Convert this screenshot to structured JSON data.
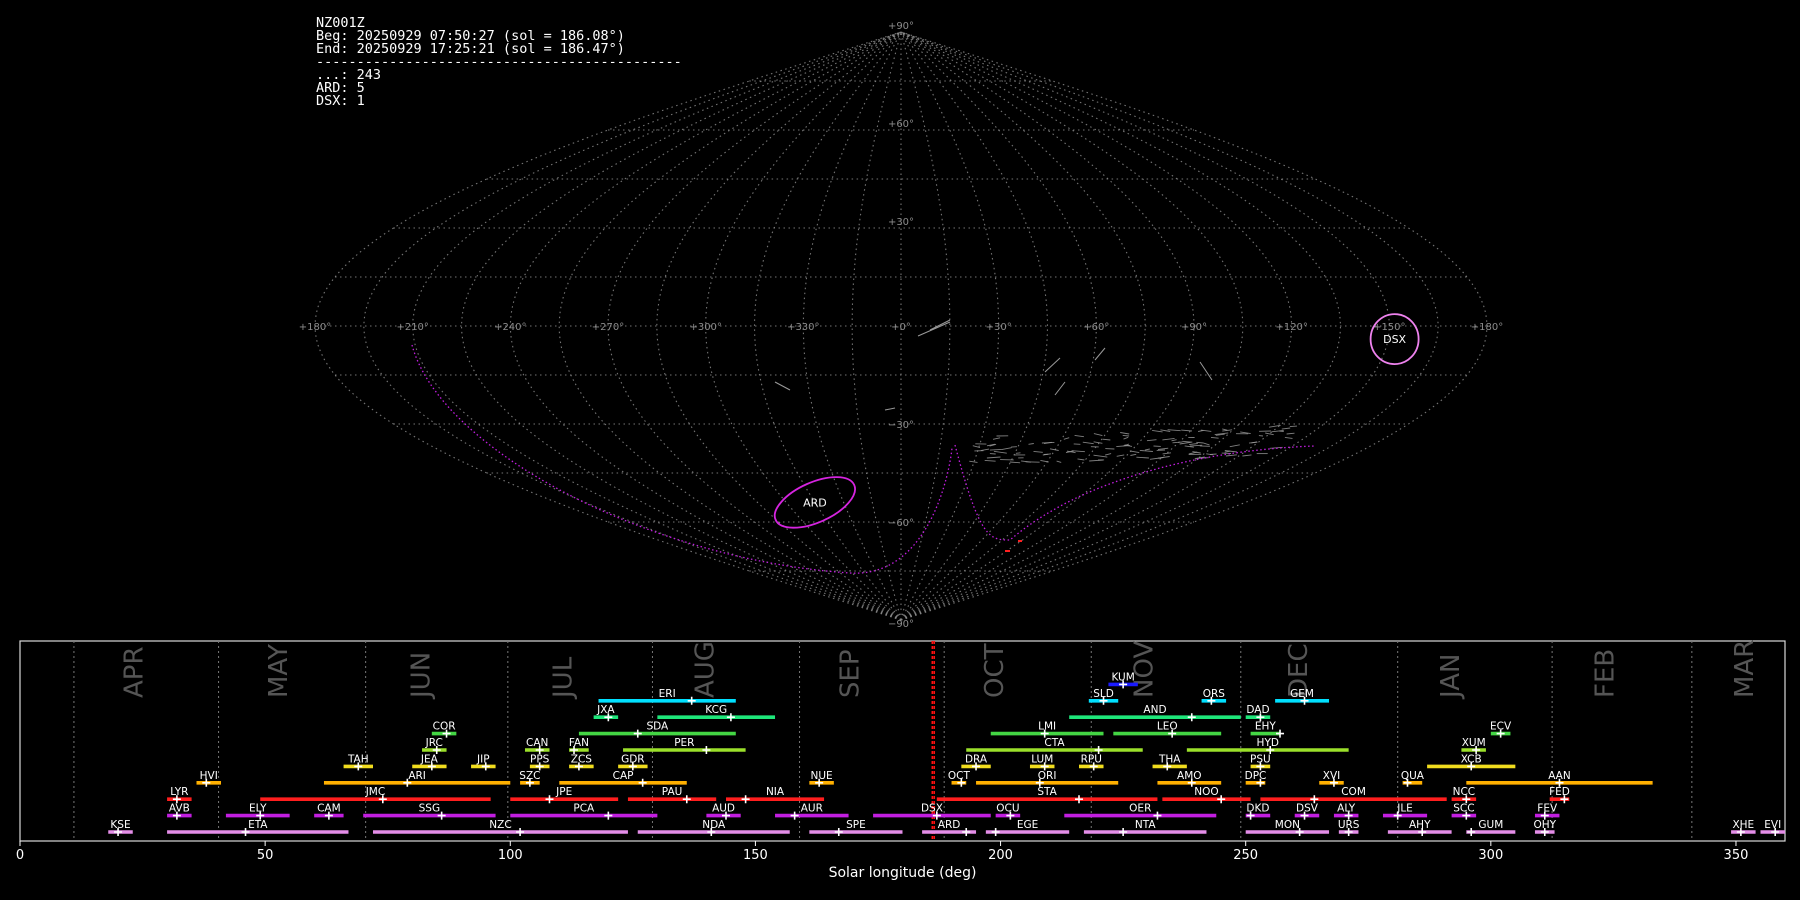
{
  "header": {
    "lines": [
      "NZ001Z",
      "Beg: 20250929 07:50:27 (sol = 186.08°)",
      "End: 20250929 17:25:21 (sol = 186.47°)",
      "---------------------------------------------",
      "...: 243",
      "ARD: 5",
      "DSX: 1"
    ]
  },
  "chart_data": [
    {
      "type": "scatter",
      "projection": "sinusoidal all-sky map",
      "grid": true,
      "lon_ticks": [
        "+180°",
        "+150°",
        "+120°",
        "+90°",
        "+60°",
        "+30°",
        "+0°",
        "+330°",
        "+300°",
        "+270°",
        "+240°",
        "+210°",
        "+180°"
      ],
      "lat_ticks": [
        "+90°",
        "+60°",
        "+30°",
        "−30°",
        "−60°",
        "−90°"
      ],
      "radiants": [
        {
          "name": "DSX",
          "lon": 152,
          "lat": -4,
          "color": "#ee82ee"
        },
        {
          "name": "ARD",
          "lon": 315,
          "lat": -54,
          "color": "#d624e0"
        }
      ],
      "counts": {
        "sporadic": 243,
        "ARD": 5,
        "DSX": 1
      }
    },
    {
      "type": "bar",
      "title": "",
      "xlabel": "Solar longitude (deg)",
      "xlim": [
        0,
        360
      ],
      "xticks": [
        0,
        50,
        100,
        150,
        200,
        250,
        300,
        350
      ],
      "current_sol": [
        186.08,
        186.47
      ],
      "months": [
        {
          "label": "APR",
          "x": 25
        },
        {
          "label": "MAY",
          "x": 54.5
        },
        {
          "label": "JUN",
          "x": 83.5
        },
        {
          "label": "JUL",
          "x": 112.5
        },
        {
          "label": "AUG",
          "x": 141.5
        },
        {
          "label": "SEP",
          "x": 171
        },
        {
          "label": "OCT",
          "x": 200.5
        },
        {
          "label": "NOV",
          "x": 231
        },
        {
          "label": "DEC",
          "x": 262.5
        },
        {
          "label": "JAN",
          "x": 293.5
        },
        {
          "label": "FEB",
          "x": 325
        },
        {
          "label": "MAR",
          "x": 353.5
        }
      ],
      "month_boundaries": [
        11,
        40.5,
        70.5,
        99.5,
        129,
        159,
        188.5,
        218.5,
        249,
        281,
        312.5,
        341
      ],
      "showers": [
        {
          "code": "KUM",
          "start": 222,
          "end": 228,
          "peak": 225,
          "row": 9,
          "color": "#1a1aff"
        },
        {
          "code": "ERI",
          "start": 118,
          "end": 146,
          "peak": 137,
          "row": 8,
          "color": "#00e0ff"
        },
        {
          "code": "SLD",
          "start": 218,
          "end": 224,
          "peak": 221,
          "row": 8,
          "color": "#00e0ff"
        },
        {
          "code": "ORS",
          "start": 241,
          "end": 246,
          "peak": 243,
          "row": 8,
          "color": "#00e0ff"
        },
        {
          "code": "GEM",
          "start": 256,
          "end": 267,
          "peak": 262,
          "row": 8,
          "color": "#00e0ff"
        },
        {
          "code": "JXA",
          "start": 117,
          "end": 122,
          "peak": 120,
          "row": 7,
          "color": "#1ee67a"
        },
        {
          "code": "KCG",
          "start": 130,
          "end": 154,
          "peak": 145,
          "row": 7,
          "color": "#1ee67a"
        },
        {
          "code": "AND",
          "start": 214,
          "end": 249,
          "peak": 239,
          "row": 7,
          "color": "#1ee67a"
        },
        {
          "code": "DAD",
          "start": 250,
          "end": 255,
          "peak": 253,
          "row": 7,
          "color": "#1ee67a"
        },
        {
          "code": "COR",
          "start": 84,
          "end": 89,
          "peak": 87,
          "row": 6,
          "color": "#44d644"
        },
        {
          "code": "SDA",
          "start": 114,
          "end": 146,
          "peak": 126,
          "row": 6,
          "color": "#44d644"
        },
        {
          "code": "LMI",
          "start": 198,
          "end": 221,
          "peak": 209,
          "row": 6,
          "color": "#44d644"
        },
        {
          "code": "LEO",
          "start": 223,
          "end": 245,
          "peak": 235,
          "row": 6,
          "color": "#44d644"
        },
        {
          "code": "EHY",
          "start": 251,
          "end": 257,
          "peak": 257,
          "row": 6,
          "color": "#44d644"
        },
        {
          "code": "ECV",
          "start": 300,
          "end": 304,
          "peak": 302,
          "row": 6,
          "color": "#44d644"
        },
        {
          "code": "JRC",
          "start": 82,
          "end": 87,
          "peak": 85,
          "row": 5,
          "color": "#9be02a"
        },
        {
          "code": "CAN",
          "start": 103,
          "end": 108,
          "peak": 106,
          "row": 5,
          "color": "#9be02a"
        },
        {
          "code": "FAN",
          "start": 112,
          "end": 116,
          "peak": 113,
          "row": 5,
          "color": "#9be02a"
        },
        {
          "code": "PER",
          "start": 123,
          "end": 148,
          "peak": 140,
          "row": 5,
          "color": "#9be02a"
        },
        {
          "code": "CTA",
          "start": 193,
          "end": 229,
          "peak": 220,
          "row": 5,
          "color": "#9be02a"
        },
        {
          "code": "HYD",
          "start": 238,
          "end": 271,
          "peak": 255,
          "row": 5,
          "color": "#9be02a"
        },
        {
          "code": "XUM",
          "start": 294,
          "end": 299,
          "peak": 297,
          "row": 5,
          "color": "#9be02a"
        },
        {
          "code": "TAH",
          "start": 66,
          "end": 72,
          "peak": 69,
          "row": 4,
          "color": "#f0dc1e"
        },
        {
          "code": "JEA",
          "start": 80,
          "end": 87,
          "peak": 84,
          "row": 4,
          "color": "#f0dc1e"
        },
        {
          "code": "JIP",
          "start": 92,
          "end": 97,
          "peak": 95,
          "row": 4,
          "color": "#f0dc1e"
        },
        {
          "code": "PPS",
          "start": 104,
          "end": 108,
          "peak": 106,
          "row": 4,
          "color": "#f0dc1e"
        },
        {
          "code": "ZCS",
          "start": 112,
          "end": 117,
          "peak": 114,
          "row": 4,
          "color": "#f0dc1e"
        },
        {
          "code": "GDR",
          "start": 122,
          "end": 128,
          "peak": 125,
          "row": 4,
          "color": "#f0dc1e"
        },
        {
          "code": "DRA",
          "start": 192,
          "end": 198,
          "peak": 195,
          "row": 4,
          "color": "#f0dc1e"
        },
        {
          "code": "LUM",
          "start": 206,
          "end": 211,
          "peak": 209,
          "row": 4,
          "color": "#f0dc1e"
        },
        {
          "code": "RPU",
          "start": 216,
          "end": 221,
          "peak": 219,
          "row": 4,
          "color": "#f0dc1e"
        },
        {
          "code": "THA",
          "start": 231,
          "end": 238,
          "peak": 234,
          "row": 4,
          "color": "#f0dc1e"
        },
        {
          "code": "PSU",
          "start": 251,
          "end": 255,
          "peak": 253,
          "row": 4,
          "color": "#f0dc1e"
        },
        {
          "code": "XCB",
          "start": 287,
          "end": 305,
          "peak": 296,
          "row": 4,
          "color": "#f0dc1e"
        },
        {
          "code": "HVI",
          "start": 36,
          "end": 41,
          "peak": 38,
          "row": 3,
          "color": "#ffb000"
        },
        {
          "code": "ARI",
          "start": 62,
          "end": 100,
          "peak": 79,
          "row": 3,
          "color": "#ffb000"
        },
        {
          "code": "SZC",
          "start": 102,
          "end": 106,
          "peak": 104,
          "row": 3,
          "color": "#ffb000"
        },
        {
          "code": "CAP",
          "start": 110,
          "end": 136,
          "peak": 127,
          "row": 3,
          "color": "#ffb000"
        },
        {
          "code": "NUE",
          "start": 161,
          "end": 166,
          "peak": 163,
          "row": 3,
          "color": "#ffb000"
        },
        {
          "code": "OCT",
          "start": 190,
          "end": 193,
          "peak": 192,
          "row": 3,
          "color": "#ffb000"
        },
        {
          "code": "ORI",
          "start": 195,
          "end": 224,
          "peak": 208,
          "row": 3,
          "color": "#ffb000"
        },
        {
          "code": "AMO",
          "start": 232,
          "end": 245,
          "peak": 239,
          "row": 3,
          "color": "#ffb000"
        },
        {
          "code": "DPC",
          "start": 250,
          "end": 254,
          "peak": 253,
          "row": 3,
          "color": "#ffb000"
        },
        {
          "code": "XVI",
          "start": 265,
          "end": 270,
          "peak": 268,
          "row": 3,
          "color": "#ffb000"
        },
        {
          "code": "QUA",
          "start": 282,
          "end": 286,
          "peak": 283,
          "row": 3,
          "color": "#ffb000"
        },
        {
          "code": "AAN",
          "start": 295,
          "end": 333,
          "peak": 314,
          "row": 3,
          "color": "#ffb000"
        },
        {
          "code": "LYR",
          "start": 30,
          "end": 35,
          "peak": 32,
          "row": 2,
          "color": "#ff1e1e"
        },
        {
          "code": "JMC",
          "start": 49,
          "end": 96,
          "peak": 74,
          "row": 2,
          "color": "#ff1e1e"
        },
        {
          "code": "JPE",
          "start": 100,
          "end": 122,
          "peak": 108,
          "row": 2,
          "color": "#ff1e1e"
        },
        {
          "code": "PAU",
          "start": 124,
          "end": 142,
          "peak": 136,
          "row": 2,
          "color": "#ff1e1e"
        },
        {
          "code": "NIA",
          "start": 144,
          "end": 164,
          "peak": 148,
          "row": 2,
          "color": "#ff1e1e"
        },
        {
          "code": "STA",
          "start": 187,
          "end": 232,
          "peak": 216,
          "row": 2,
          "color": "#ff1e1e"
        },
        {
          "code": "NOO",
          "start": 233,
          "end": 251,
          "peak": 245,
          "row": 2,
          "color": "#ff1e1e"
        },
        {
          "code": "COM",
          "start": 253,
          "end": 291,
          "peak": 264,
          "row": 2,
          "color": "#ff1e1e"
        },
        {
          "code": "NCC",
          "start": 292,
          "end": 297,
          "peak": 295,
          "row": 2,
          "color": "#ff1e1e"
        },
        {
          "code": "FED",
          "start": 312,
          "end": 316,
          "peak": 315,
          "row": 2,
          "color": "#ff1e1e"
        },
        {
          "code": "AVB",
          "start": 30,
          "end": 35,
          "peak": 32,
          "row": 1,
          "color": "#c21ee0"
        },
        {
          "code": "ELY",
          "start": 42,
          "end": 55,
          "peak": 49,
          "row": 1,
          "color": "#c21ee0"
        },
        {
          "code": "CAM",
          "start": 60,
          "end": 66,
          "peak": 63,
          "row": 1,
          "color": "#c21ee0"
        },
        {
          "code": "SSG",
          "start": 70,
          "end": 97,
          "peak": 86,
          "row": 1,
          "color": "#c21ee0"
        },
        {
          "code": "PCA",
          "start": 100,
          "end": 130,
          "peak": 120,
          "row": 1,
          "color": "#c21ee0"
        },
        {
          "code": "AUD",
          "start": 140,
          "end": 147,
          "peak": 144,
          "row": 1,
          "color": "#c21ee0"
        },
        {
          "code": "AUR",
          "start": 154,
          "end": 169,
          "peak": 158,
          "row": 1,
          "color": "#c21ee0"
        },
        {
          "code": "DSX",
          "start": 174,
          "end": 198,
          "peak": 187,
          "row": 1,
          "color": "#c21ee0"
        },
        {
          "code": "OCU",
          "start": 199,
          "end": 204,
          "peak": 202,
          "row": 1,
          "color": "#c21ee0"
        },
        {
          "code": "OER",
          "start": 213,
          "end": 244,
          "peak": 232,
          "row": 1,
          "color": "#c21ee0"
        },
        {
          "code": "DKD",
          "start": 250,
          "end": 255,
          "peak": 251,
          "row": 1,
          "color": "#c21ee0"
        },
        {
          "code": "DSV",
          "start": 260,
          "end": 265,
          "peak": 262,
          "row": 1,
          "color": "#c21ee0"
        },
        {
          "code": "ALY",
          "start": 268,
          "end": 273,
          "peak": 271,
          "row": 1,
          "color": "#c21ee0"
        },
        {
          "code": "JLE",
          "start": 278,
          "end": 287,
          "peak": 281,
          "row": 1,
          "color": "#c21ee0"
        },
        {
          "code": "SCC",
          "start": 292,
          "end": 297,
          "peak": 295,
          "row": 1,
          "color": "#c21ee0"
        },
        {
          "code": "FEV",
          "start": 309,
          "end": 314,
          "peak": 311,
          "row": 1,
          "color": "#c21ee0"
        },
        {
          "code": "KSE",
          "start": 18,
          "end": 23,
          "peak": 20,
          "row": 0,
          "color": "#e48ee8"
        },
        {
          "code": "ETA",
          "start": 30,
          "end": 67,
          "peak": 46,
          "row": 0,
          "color": "#e48ee8"
        },
        {
          "code": "NZC",
          "start": 72,
          "end": 124,
          "peak": 102,
          "row": 0,
          "color": "#e48ee8"
        },
        {
          "code": "NDA",
          "start": 126,
          "end": 157,
          "peak": 141,
          "row": 0,
          "color": "#e48ee8"
        },
        {
          "code": "SPE",
          "start": 161,
          "end": 180,
          "peak": 167,
          "row": 0,
          "color": "#e48ee8"
        },
        {
          "code": "ARD",
          "start": 184,
          "end": 195,
          "peak": 193,
          "row": 0,
          "color": "#e48ee8"
        },
        {
          "code": "EGE",
          "start": 197,
          "end": 214,
          "peak": 199,
          "row": 0,
          "color": "#e48ee8"
        },
        {
          "code": "NTA",
          "start": 217,
          "end": 242,
          "peak": 225,
          "row": 0,
          "color": "#e48ee8"
        },
        {
          "code": "MON",
          "start": 250,
          "end": 267,
          "peak": 261,
          "row": 0,
          "color": "#e48ee8"
        },
        {
          "code": "URS",
          "start": 269,
          "end": 273,
          "peak": 271,
          "row": 0,
          "color": "#e48ee8"
        },
        {
          "code": "AHY",
          "start": 279,
          "end": 292,
          "peak": 286,
          "row": 0,
          "color": "#e48ee8"
        },
        {
          "code": "GUM",
          "start": 295,
          "end": 305,
          "peak": 296,
          "row": 0,
          "color": "#e48ee8"
        },
        {
          "code": "OHY",
          "start": 309,
          "end": 313,
          "peak": 311,
          "row": 0,
          "color": "#e48ee8"
        },
        {
          "code": "XHE",
          "start": 349,
          "end": 354,
          "peak": 351,
          "row": 0,
          "color": "#e48ee8"
        },
        {
          "code": "EVI",
          "start": 355,
          "end": 360,
          "peak": 358,
          "row": 0,
          "color": "#e48ee8"
        }
      ]
    }
  ]
}
